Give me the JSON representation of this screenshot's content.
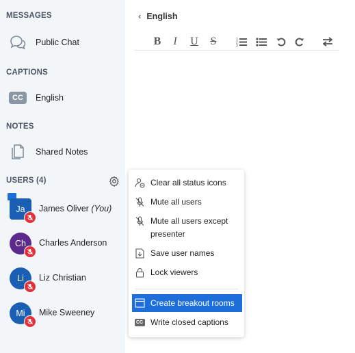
{
  "sidebar": {
    "messages_title": "MESSAGES",
    "public_chat_label": "Public Chat",
    "captions_title": "CAPTIONS",
    "caption_english_label": "English",
    "caption_icon_text": "CC",
    "notes_title": "NOTES",
    "shared_notes_label": "Shared Notes",
    "users_title": "USERS (4)",
    "users": [
      {
        "initials": "Ja",
        "name": "James Oliver",
        "suffix": "(You)",
        "color": "#1a5fb4",
        "presenter": true
      },
      {
        "initials": "Ch",
        "name": "Charles Anderson",
        "suffix": "",
        "color": "#5b2a8c",
        "presenter": false
      },
      {
        "initials": "Li",
        "name": "Liz Christian",
        "suffix": "",
        "color": "#1a5fb4",
        "presenter": false
      },
      {
        "initials": "Mi",
        "name": "Mike Sweeney",
        "suffix": "",
        "color": "#1a5fb4",
        "presenter": false
      }
    ]
  },
  "editor": {
    "title": "English",
    "toolbar": [
      "B",
      "I",
      "U",
      "S"
    ]
  },
  "menu": {
    "items": [
      {
        "label": "Clear all status icons"
      },
      {
        "label": "Mute all users"
      },
      {
        "label": "Mute all users except presenter"
      },
      {
        "label": "Save user names"
      },
      {
        "label": "Lock viewers"
      },
      {
        "label": "Create breakout rooms"
      },
      {
        "label": "Write closed captions"
      }
    ],
    "cc_icon_text": "CC"
  },
  "colors": {
    "accent": "#1d6ed8",
    "muted_mic": "#e0323c",
    "sidebar_bg": "#f3f6f9"
  }
}
